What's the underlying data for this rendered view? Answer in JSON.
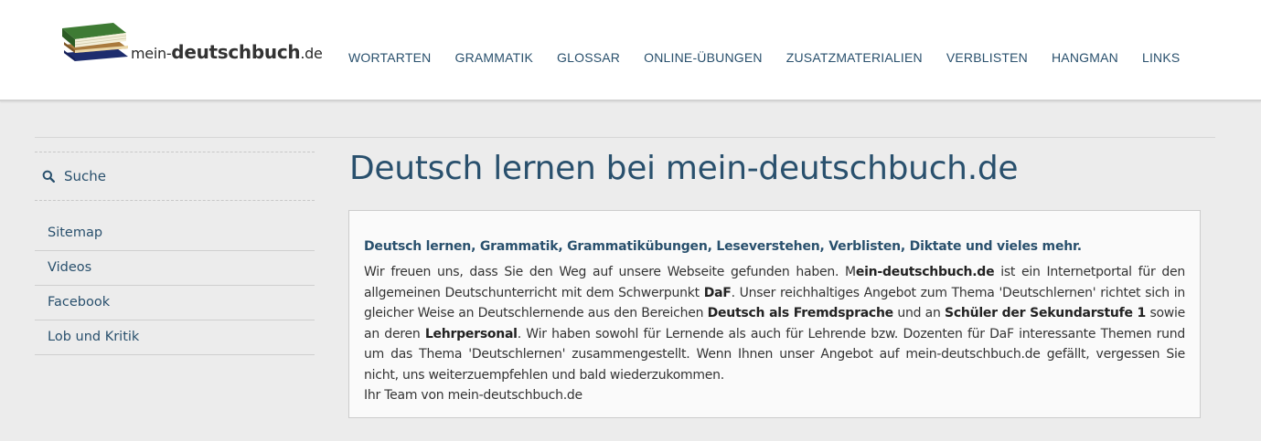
{
  "header": {
    "logo": {
      "prefix": "mein-",
      "main": "deutschbuch",
      "tld": ".de"
    },
    "nav": [
      "WORTARTEN",
      "GRAMMATIK",
      "GLOSSAR",
      "ONLINE-ÜBUNGEN",
      "ZUSATZMATERIALIEN",
      "VERBLISTEN",
      "HANGMAN",
      "LINKS"
    ]
  },
  "sidebar": {
    "search_label": "Suche",
    "items": [
      "Sitemap",
      "Videos",
      "Facebook",
      "Lob und Kritik"
    ]
  },
  "main": {
    "title": "Deutsch lernen bei mein-deutschbuch.de",
    "subtitle": "Deutsch lernen, Grammatik, Grammatikübungen, Leseverstehen, Verblisten, Diktate und vieles mehr.",
    "paragraph": {
      "t1": "Wir freuen uns, dass Sie den Weg auf unsere Webseite gefunden haben. M",
      "b1": "ein-deutschbuch.de",
      "t2": " ist ein Internetportal für den allgemeinen Deutschunterricht mit dem Schwerpunkt ",
      "b2": "DaF",
      "t3": ". Unser reichhaltiges Angebot zum Thema 'Deutschlernen' richtet sich in gleicher Weise an Deutschlernende aus den Bereichen ",
      "b3": "Deutsch als Fremdsprache",
      "t4": " und an ",
      "b4": "Schüler der Sekundarstufe 1",
      "t5": " sowie an deren ",
      "b5": "Lehrpersonal",
      "t6": ". Wir haben sowohl für Lernende als auch für Lehrende bzw. Dozenten für DaF interessante Themen rund um das Thema 'Deutschlernen' zusammengestellt. Wenn Ihnen unser Angebot auf mein-deutschbuch.de gefällt, vergessen Sie nicht, uns weiterzuempfehlen und bald wiederzukommen.",
      "sign": "Ihr Team von mein-deutschbuch.de"
    }
  },
  "colors": {
    "link": "#29506d",
    "background": "#ececec",
    "header": "#ffffff"
  },
  "icons": {
    "logo": "books-icon",
    "search": "search-icon"
  }
}
